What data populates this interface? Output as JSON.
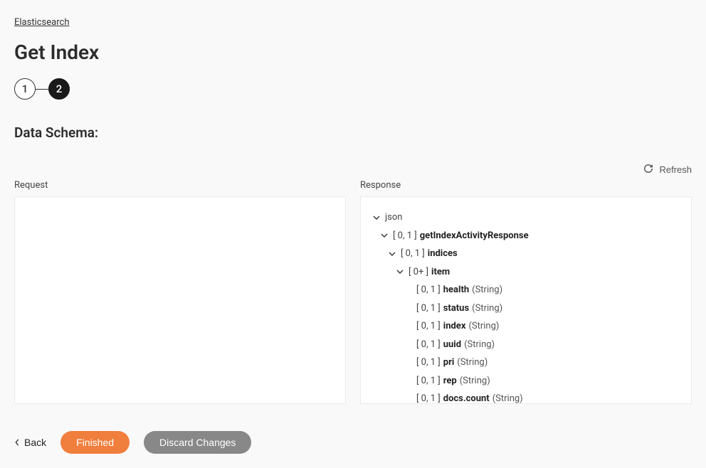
{
  "breadcrumb": {
    "parent": "Elasticsearch"
  },
  "page_title": "Get Index",
  "stepper": {
    "step1": "1",
    "step2": "2"
  },
  "section_title": "Data Schema:",
  "refresh_label": "Refresh",
  "panels": {
    "request_label": "Request",
    "response_label": "Response"
  },
  "tree": {
    "root": {
      "label": "json",
      "expandable": true
    },
    "level1": {
      "cardinality": "[ 0, 1 ]",
      "name": "getIndexActivityResponse",
      "expandable": true
    },
    "level2": {
      "cardinality": "[ 0, 1 ]",
      "name": "indices",
      "expandable": true
    },
    "level3": {
      "cardinality": "[ 0+ ]",
      "name": "item",
      "expandable": true
    },
    "fields": [
      {
        "cardinality": "[ 0, 1 ]",
        "name": "health",
        "type": "(String)"
      },
      {
        "cardinality": "[ 0, 1 ]",
        "name": "status",
        "type": "(String)"
      },
      {
        "cardinality": "[ 0, 1 ]",
        "name": "index",
        "type": "(String)"
      },
      {
        "cardinality": "[ 0, 1 ]",
        "name": "uuid",
        "type": "(String)"
      },
      {
        "cardinality": "[ 0, 1 ]",
        "name": "pri",
        "type": "(String)"
      },
      {
        "cardinality": "[ 0, 1 ]",
        "name": "rep",
        "type": "(String)"
      },
      {
        "cardinality": "[ 0, 1 ]",
        "name": "docs.count",
        "type": "(String)"
      }
    ]
  },
  "footer": {
    "back_label": "Back",
    "finished_label": "Finished",
    "discard_label": "Discard Changes"
  }
}
